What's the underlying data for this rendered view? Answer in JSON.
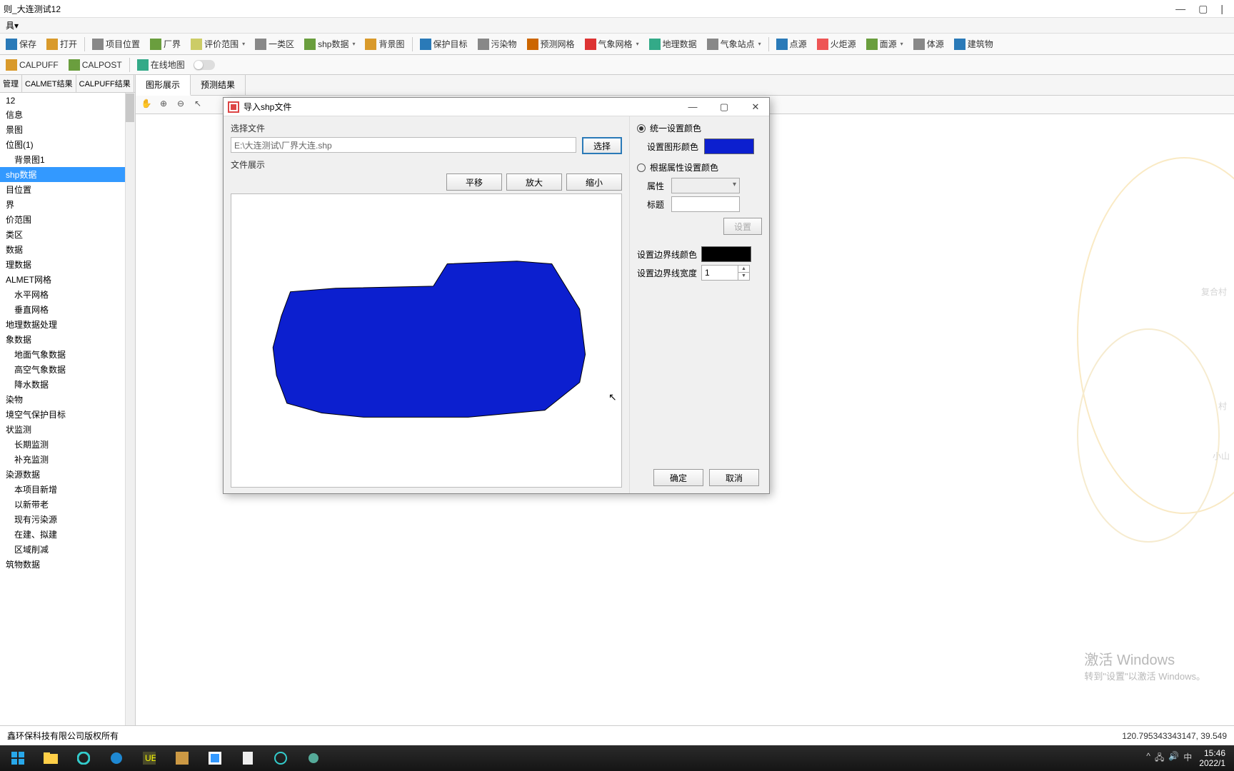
{
  "window": {
    "title": "则_大连测试12"
  },
  "menubar": {
    "item1": "具▾"
  },
  "toolbar1": {
    "save": "保存",
    "open": "打开",
    "project_pos": "项目位置",
    "factory": "厂界",
    "eval_range": "评价范围",
    "zone": "一类区",
    "shp_data": "shp数据",
    "bg_image": "背景图",
    "protect": "保护目标",
    "pollutant": "污染物",
    "predict_grid": "预测网格",
    "met_grid": "气象网格",
    "geo_data": "地理数据",
    "met_station": "气象站点",
    "point_source": "点源",
    "torch_source": "火炬源",
    "area_source": "面源",
    "volume_source": "体源",
    "building": "建筑物"
  },
  "toolbar2": {
    "calpuff": "CALPUFF",
    "calpost": "CALPOST",
    "online_map": "在线地图"
  },
  "left_panel": {
    "tabs": [
      "管理",
      "CALMET结果",
      "CALPUFF结果"
    ],
    "tree": [
      {
        "label": "12",
        "i": 0
      },
      {
        "label": "信息",
        "i": 0
      },
      {
        "label": "景图",
        "i": 0
      },
      {
        "label": "位图(1)",
        "i": 0
      },
      {
        "label": "背景图1",
        "i": 1
      },
      {
        "label": "shp数据",
        "i": 0,
        "sel": true
      },
      {
        "label": "目位置",
        "i": 0
      },
      {
        "label": "界",
        "i": 0
      },
      {
        "label": "价范围",
        "i": 0
      },
      {
        "label": "类区",
        "i": 0
      },
      {
        "label": "数据",
        "i": 0
      },
      {
        "label": "理数据",
        "i": 0
      },
      {
        "label": "ALMET网格",
        "i": 0
      },
      {
        "label": "水平网格",
        "i": 1
      },
      {
        "label": "垂直网格",
        "i": 1
      },
      {
        "label": "地理数据处理",
        "i": 0
      },
      {
        "label": "象数据",
        "i": 0
      },
      {
        "label": "地面气象数据",
        "i": 1
      },
      {
        "label": "高空气象数据",
        "i": 1
      },
      {
        "label": "降水数据",
        "i": 1
      },
      {
        "label": "染物",
        "i": 0
      },
      {
        "label": "境空气保护目标",
        "i": 0
      },
      {
        "label": "状监测",
        "i": 0
      },
      {
        "label": "长期监测",
        "i": 1
      },
      {
        "label": "补充监测",
        "i": 1
      },
      {
        "label": "染源数据",
        "i": 0
      },
      {
        "label": "本项目新增",
        "i": 1
      },
      {
        "label": "以新带老",
        "i": 1
      },
      {
        "label": "现有污染源",
        "i": 1
      },
      {
        "label": "在建、拟建",
        "i": 1
      },
      {
        "label": "区域削减",
        "i": 1
      },
      {
        "label": "筑物数据",
        "i": 0
      }
    ]
  },
  "center": {
    "tabs": [
      "图形展示",
      "预测结果"
    ],
    "active": 0
  },
  "dialog": {
    "title": "导入shp文件",
    "select_file_label": "选择文件",
    "file_path": "E:\\大连测试\\厂界大连.shp",
    "select_btn": "选择",
    "file_preview_label": "文件展示",
    "pan_btn": "平移",
    "zoomin_btn": "放大",
    "zoomout_btn": "缩小",
    "unified_color_label": "统一设置颜色",
    "set_shape_color_label": "设置图形颜色",
    "shape_color": "#0c1fcf",
    "by_attr_color_label": "根据属性设置颜色",
    "attr_label": "属性",
    "title_label": "标题",
    "set_btn": "设置",
    "border_color_label": "设置边界线颜色",
    "border_color": "#000000",
    "border_width_label": "设置边界线宽度",
    "border_width": "1",
    "ok_btn": "确定",
    "cancel_btn": "取消"
  },
  "map_labels": {
    "l1": "复合村",
    "l2": "村",
    "l3": "小山"
  },
  "watermark": {
    "line1": "激活 Windows",
    "line2": "转到\"设置\"以激活 Windows。"
  },
  "statusbar": {
    "left": "鑫环保科技有限公司版权所有",
    "right": "120.795343343147, 39.549"
  },
  "taskbar": {
    "time": "15:46",
    "date": "2022/1",
    "ime": "中"
  }
}
